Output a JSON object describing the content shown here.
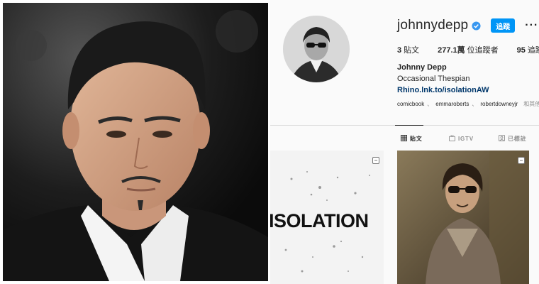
{
  "profile": {
    "username": "johnnydepp",
    "follow_label": "追蹤",
    "more_label": "···",
    "stats": [
      {
        "value": "3",
        "label": "貼文"
      },
      {
        "value": "277.1萬",
        "label": "位追蹤者"
      },
      {
        "value": "95",
        "label": "追蹤"
      }
    ],
    "full_name": "Johnny Depp",
    "bio": "Occasional Thespian",
    "link": "Rhino.lnk.to/isolationAW",
    "tagged_users": [
      "comicbook",
      "emmaroberts",
      "robertdowneyjr"
    ],
    "tagged_tail": "和其他"
  },
  "tabs": [
    {
      "label": "貼文",
      "icon": "grid-icon"
    },
    {
      "label": "IGTV",
      "icon": "igtv-icon"
    },
    {
      "label": "已標註",
      "icon": "tagged-icon"
    }
  ],
  "posts": [
    {
      "title": "ISOLATION"
    }
  ],
  "colors": {
    "accent": "#0095f6",
    "link": "#00376b",
    "verified": "#3897f0",
    "muted": "#8e8e8e"
  }
}
